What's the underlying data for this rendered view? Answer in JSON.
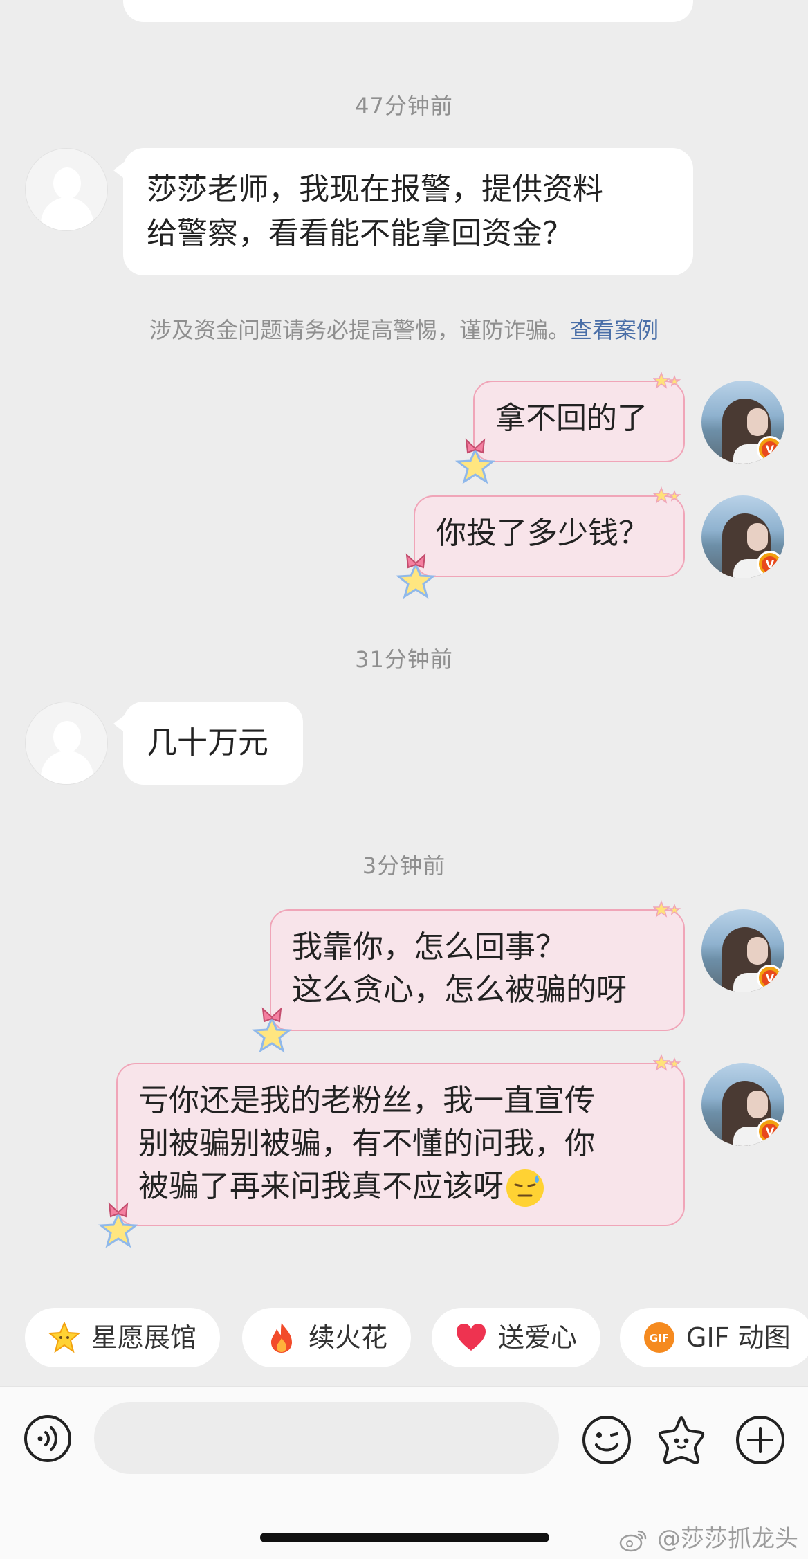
{
  "timestamps": {
    "t1": "47分钟前",
    "t2": "31分钟前",
    "t3": "3分钟前"
  },
  "messages": {
    "m1_line1": "莎莎老师，我现在报警，提供资料",
    "m1_line2": "给警察，看看能不能拿回资金？",
    "m2": "拿不回的了",
    "m3": "你投了多少钱？",
    "m4": "几十万元",
    "m5_line1": "我靠你，怎么回事？",
    "m5_line2": "这么贪心，怎么被骗的呀",
    "m6_line1": "亏你还是我的老粉丝，我一直宣传",
    "m6_line2": "别被骗别被骗，有不懂的问我，你",
    "m6_line3": "被骗了再来问我真不应该呀"
  },
  "warning": {
    "text": "涉及资金问题请务必提高警惕，谨防诈骗。",
    "link": "查看案例"
  },
  "quick_actions": [
    {
      "label": "星愿展馆",
      "icon": "star-face-icon"
    },
    {
      "label": "续火花",
      "icon": "fire-icon"
    },
    {
      "label": "送爱心",
      "icon": "heart-icon"
    },
    {
      "label": "GIF 动图",
      "icon": "gif-icon"
    }
  ],
  "input": {
    "placeholder": ""
  },
  "watermark": "@莎莎抓龙头",
  "colors": {
    "background": "#ededed",
    "bubble_self": "#f8e4ea",
    "bubble_self_border": "#f0a5b8",
    "link": "#4a6fa8",
    "verified_badge": "#f2a10f"
  }
}
